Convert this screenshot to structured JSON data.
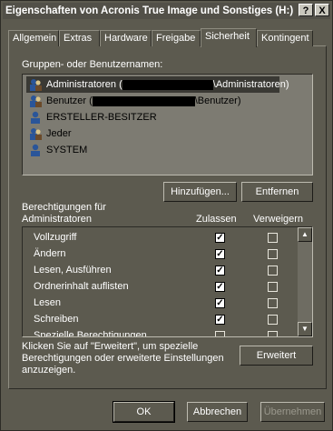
{
  "window": {
    "title": "Eigenschaften von Acronis True Image und Sonstiges (H:)",
    "help_label": "?",
    "close_label": "X"
  },
  "tabs": [
    {
      "label": "Allgemein"
    },
    {
      "label": "Extras"
    },
    {
      "label": "Hardware"
    },
    {
      "label": "Freigabe"
    },
    {
      "label": "Sicherheit",
      "active": true
    },
    {
      "label": "Kontingent"
    }
  ],
  "security": {
    "groups_label": "Gruppen- oder Benutzernamen:",
    "users": [
      {
        "prefix": "Administratoren (",
        "suffix": "\\Administratoren)",
        "selected": true
      },
      {
        "prefix": "Benutzer (",
        "suffix": "\\Benutzer)"
      },
      {
        "label": "ERSTELLER-BESITZER"
      },
      {
        "label": "Jeder"
      },
      {
        "label": "SYSTEM"
      }
    ],
    "add_button": "Hinzufügen...",
    "remove_button": "Entfernen",
    "perm_header_line1": "Berechtigungen für",
    "perm_header_line2": "Administratoren",
    "allow_header": "Zulassen",
    "deny_header": "Verweigern",
    "permissions": [
      {
        "name": "Vollzugriff",
        "allow": true,
        "deny": false
      },
      {
        "name": "Ändern",
        "allow": true,
        "deny": false
      },
      {
        "name": "Lesen, Ausführen",
        "allow": true,
        "deny": false
      },
      {
        "name": "Ordnerinhalt auflisten",
        "allow": true,
        "deny": false
      },
      {
        "name": "Lesen",
        "allow": true,
        "deny": false
      },
      {
        "name": "Schreiben",
        "allow": true,
        "deny": false
      },
      {
        "name": "Spezielle Berechtigungen",
        "allow": false,
        "deny": false
      }
    ],
    "advanced_text_line1": "Klicken Sie auf \"Erweitert\", um spezielle",
    "advanced_text_line2": "Berechtigungen oder erweiterte Einstellungen",
    "advanced_text_line3": "anzuzeigen.",
    "advanced_button": "Erweitert"
  },
  "footer": {
    "ok_button": "OK",
    "cancel_button": "Abbrechen",
    "apply_button": "Übernehmen"
  }
}
